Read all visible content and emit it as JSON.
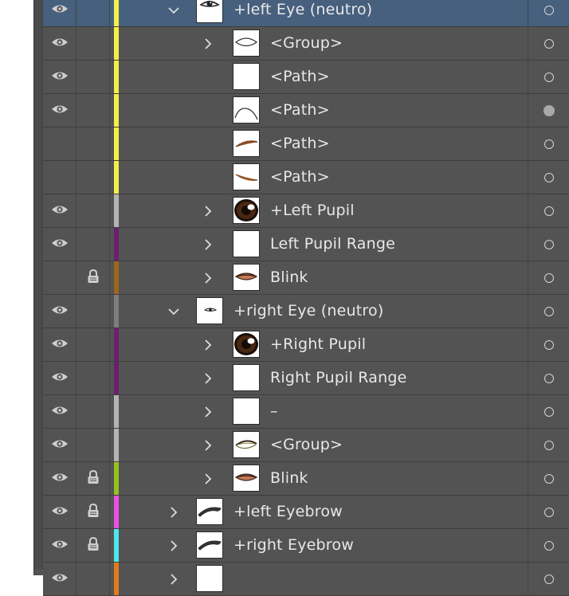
{
  "colors": {
    "panel_bg": "#535353",
    "selected_bg": "#46607e",
    "text": "#e8e8e8"
  },
  "layers": [
    {
      "name": "+left Eye (neutro)",
      "visible": true,
      "locked": false,
      "color": "#f5ef4a",
      "expander": "expanded",
      "depth": 1,
      "thumb": "eye-open",
      "selected": true,
      "target": "ring"
    },
    {
      "name": "<Group>",
      "visible": true,
      "locked": false,
      "color": "#f5ef4a",
      "expander": "collapsed",
      "depth": 2,
      "thumb": "eye-outline",
      "selected": false,
      "target": "ring"
    },
    {
      "name": "<Path>",
      "visible": true,
      "locked": false,
      "color": "#f5ef4a",
      "expander": "none",
      "depth": 2,
      "thumb": "blank",
      "selected": false,
      "target": "ring"
    },
    {
      "name": "<Path>",
      "visible": true,
      "locked": false,
      "color": "#f5ef4a",
      "expander": "none",
      "depth": 2,
      "thumb": "arc-line",
      "selected": false,
      "target": "filled"
    },
    {
      "name": "<Path>",
      "visible": false,
      "locked": false,
      "color": "#f5ef4a",
      "expander": "none",
      "depth": 2,
      "thumb": "brown-stroke-up",
      "selected": false,
      "target": "ring"
    },
    {
      "name": "<Path>",
      "visible": false,
      "locked": false,
      "color": "#f5ef4a",
      "expander": "none",
      "depth": 2,
      "thumb": "brown-stroke-down",
      "selected": false,
      "target": "ring"
    },
    {
      "name": "+Left Pupil",
      "visible": true,
      "locked": false,
      "color": "#b4b4b4",
      "expander": "collapsed",
      "depth": 2,
      "thumb": "pupil",
      "selected": false,
      "target": "ring"
    },
    {
      "name": "Left Pupil Range",
      "visible": true,
      "locked": false,
      "color": "#6b1f6e",
      "expander": "collapsed",
      "depth": 2,
      "thumb": "blank",
      "selected": false,
      "target": "ring"
    },
    {
      "name": "Blink",
      "visible": false,
      "locked": true,
      "color": "#a0651c",
      "expander": "collapsed",
      "depth": 2,
      "thumb": "blink",
      "selected": false,
      "target": "ring"
    },
    {
      "name": "+right  Eye (neutro)",
      "visible": true,
      "locked": false,
      "color": "#7d7d7d",
      "expander": "expanded",
      "depth": 1,
      "thumb": "eye-small",
      "selected": false,
      "target": "ring"
    },
    {
      "name": "+Right Pupil",
      "visible": true,
      "locked": false,
      "color": "#6b1f6e",
      "expander": "collapsed",
      "depth": 2,
      "thumb": "pupil",
      "selected": false,
      "target": "ring"
    },
    {
      "name": "Right Pupil Range",
      "visible": true,
      "locked": false,
      "color": "#6b1f6e",
      "expander": "collapsed",
      "depth": 2,
      "thumb": "blank",
      "selected": false,
      "target": "ring"
    },
    {
      "name": "–",
      "visible": true,
      "locked": false,
      "color": "#b4b4b4",
      "expander": "collapsed",
      "depth": 2,
      "thumb": "blank",
      "selected": false,
      "target": "ring"
    },
    {
      "name": "<Group>",
      "visible": true,
      "locked": false,
      "color": "#b4b4b4",
      "expander": "collapsed",
      "depth": 2,
      "thumb": "eye-lash",
      "selected": false,
      "target": "ring"
    },
    {
      "name": "Blink",
      "visible": true,
      "locked": true,
      "color": "#94c11f",
      "expander": "collapsed",
      "depth": 2,
      "thumb": "blink",
      "selected": false,
      "target": "ring"
    },
    {
      "name": "+left Eyebrow",
      "visible": true,
      "locked": true,
      "color": "#ec4fe6",
      "expander": "collapsed",
      "depth": 1,
      "thumb": "eyebrow",
      "selected": false,
      "target": "ring"
    },
    {
      "name": "+right Eyebrow",
      "visible": true,
      "locked": true,
      "color": "#4fe8ec",
      "expander": "collapsed",
      "depth": 1,
      "thumb": "eyebrow",
      "selected": false,
      "target": "ring"
    },
    {
      "name": "",
      "visible": true,
      "locked": false,
      "color": "#e07a1f",
      "expander": "collapsed",
      "depth": 1,
      "thumb": "blank",
      "selected": false,
      "target": "ring"
    }
  ]
}
